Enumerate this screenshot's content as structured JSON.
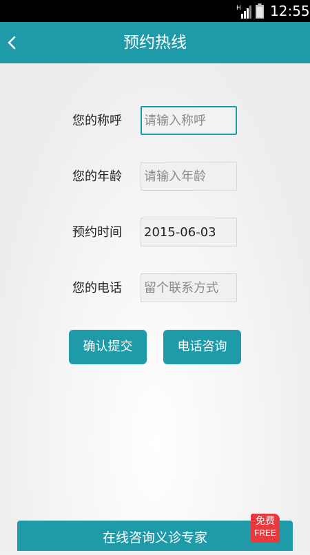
{
  "status_bar": {
    "time": "12:55",
    "network_label": "H",
    "signal_icon": "signal-bars-icon",
    "battery_icon": "battery-icon"
  },
  "header": {
    "title": "预约热线",
    "back_icon": "chevron-left-icon",
    "background_color": "#1e9aa9"
  },
  "form": {
    "fields": [
      {
        "label": "您的称呼",
        "placeholder": "请输入称呼",
        "value": ""
      },
      {
        "label": "您的年龄",
        "placeholder": "请输入年龄",
        "value": ""
      },
      {
        "label": "预约时间",
        "placeholder": "",
        "value": "2015-06-03"
      },
      {
        "label": "您的电话",
        "placeholder": "留个联系方式",
        "value": ""
      }
    ]
  },
  "buttons": {
    "confirm_label": "确认提交",
    "phone_label": "电话咨询"
  },
  "bottom_bar": {
    "label": "在线咨询义诊专家",
    "badge_line1": "免费",
    "badge_line2": "FREE",
    "badge_color": "#e63a3f"
  }
}
